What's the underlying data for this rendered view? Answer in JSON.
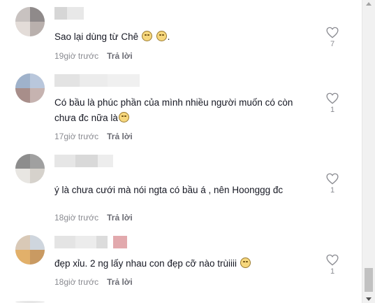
{
  "comments": [
    {
      "text": "Sao lại dùng từ Chê ",
      "text_tail": ".",
      "emoji_count": 2,
      "time": "19giờ trước",
      "reply_label": "Trả lời",
      "like_count": "7"
    },
    {
      "text": "Có bầu là phúc phần của mình nhiều người muốn có còn chưa đc nữa là",
      "emoji_count": 1,
      "time": "17giờ trước",
      "reply_label": "Trả lời",
      "like_count": "1"
    },
    {
      "text": "ý là chưa cưới mà nói ngta có bầu á , nên Hoonggg đc",
      "emoji_count": 0,
      "time": "18giờ trước",
      "reply_label": "Trả lời",
      "like_count": "1"
    },
    {
      "text": "đẹp xỉu. 2 ng lấy nhau con đẹp cỡ nào trùiiii ",
      "emoji_count": 1,
      "time": "18giờ trước",
      "reply_label": "Trả lời",
      "like_count": "1"
    }
  ],
  "icons": {
    "like": "heart-outline-icon",
    "emoji": "flushed-face-emoji"
  },
  "colors": {
    "text": "#161823",
    "muted": "#8a8b91",
    "emoji": "#f6d77d"
  }
}
